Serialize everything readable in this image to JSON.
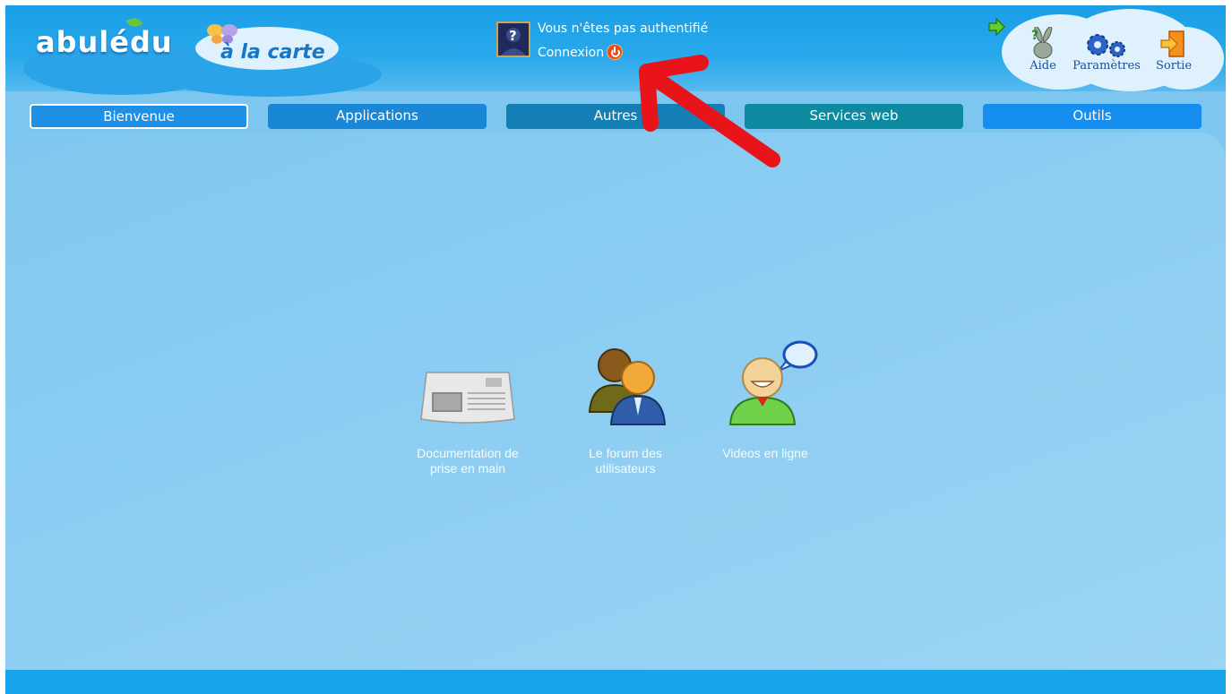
{
  "header": {
    "logo_text": "abulédu",
    "sublogo_text": "à la carte",
    "auth_status": "Vous n'êtes pas authentifié",
    "login_label": "Connexion"
  },
  "tools": [
    {
      "label": "Aide",
      "icon": "help-rabbit-icon"
    },
    {
      "label": "Paramètres",
      "icon": "gears-icon"
    },
    {
      "label": "Sortie",
      "icon": "exit-door-icon"
    }
  ],
  "tabs": [
    {
      "label": "Bienvenue",
      "color": "#1e90e8",
      "active": true
    },
    {
      "label": "Applications",
      "color": "#1a86d6"
    },
    {
      "label": "Autres",
      "color": "#147fb4"
    },
    {
      "label": "Services web",
      "color": "#0e8aa0"
    },
    {
      "label": "Outils",
      "color": "#168ef0"
    }
  ],
  "cards": [
    {
      "label": "Documentation de prise en main",
      "icon": "newspaper-icon"
    },
    {
      "label": "Le forum des utilisateurs",
      "icon": "users-group-icon"
    },
    {
      "label": "Videos en ligne",
      "icon": "user-chat-icon"
    }
  ],
  "colors": {
    "accent": "#1a9ee6",
    "content_bg": "#80c8f0",
    "annotation": "#e8141a"
  }
}
